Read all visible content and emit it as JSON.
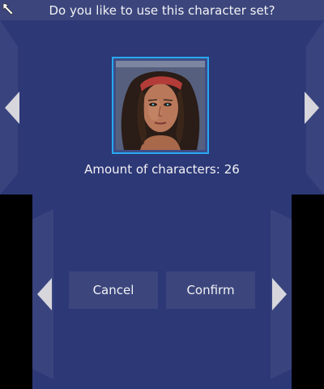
{
  "dialog": {
    "question": "Do you like to use this character set?"
  },
  "character_set": {
    "count_label": "Amount of characters:",
    "count_value": "26"
  },
  "buttons": {
    "cancel": "Cancel",
    "confirm": "Confirm"
  },
  "icons": {
    "pointer": "stylus-pointer-icon",
    "prev_top": "arrow-left-icon",
    "next_top": "arrow-right-icon",
    "prev_bottom": "arrow-left-icon",
    "next_bottom": "arrow-right-icon"
  },
  "colors": {
    "background": "#2d3877",
    "panel": "#3c467d",
    "selection_border": "#28a8f0",
    "text": "#f2f2f4",
    "arrow": "#d6d6dc"
  }
}
